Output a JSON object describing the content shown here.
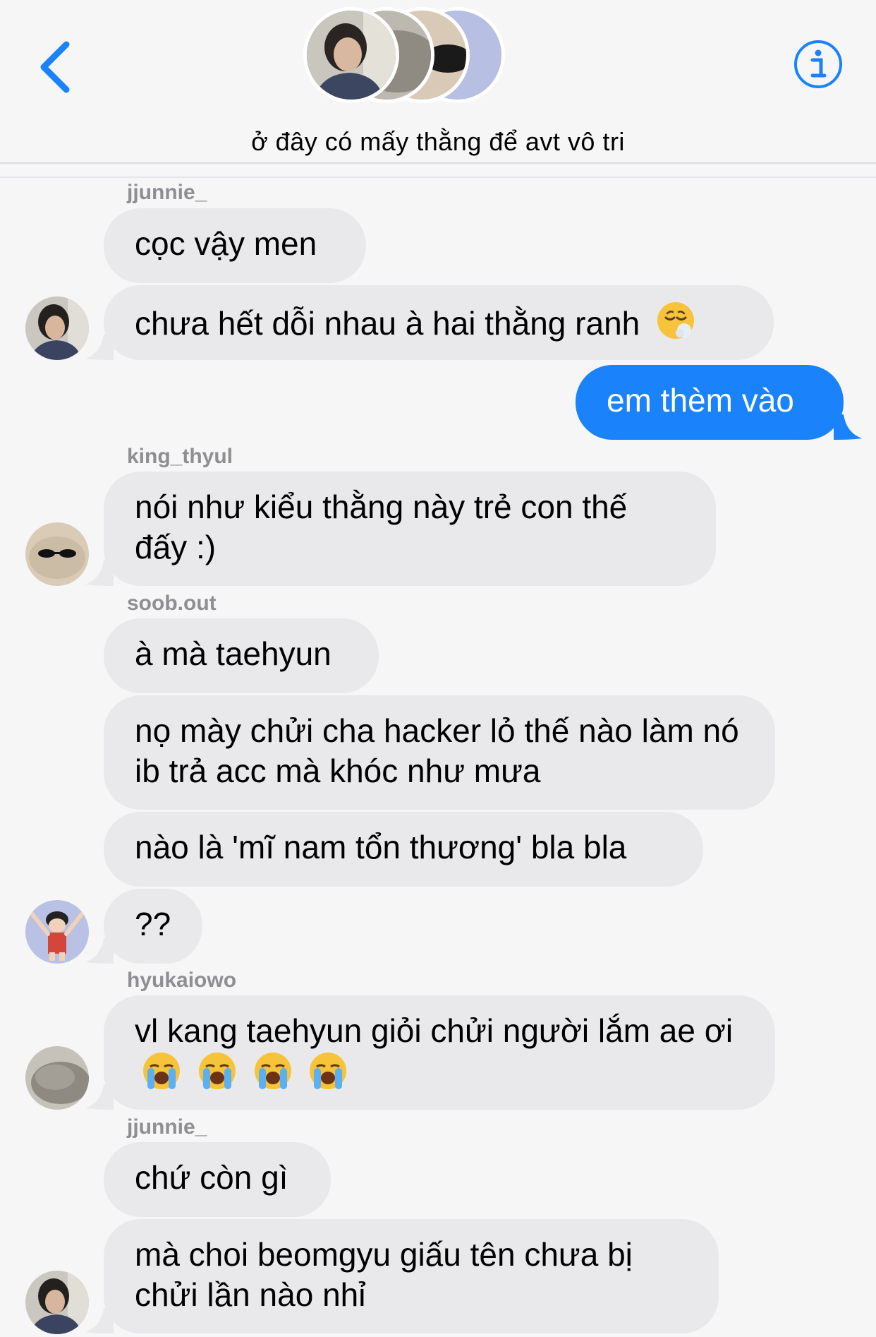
{
  "header": {
    "title": "ở đây có mấy thằng để avt vô tri",
    "accent": "#1a82fb"
  },
  "messages": [
    {
      "user": "jjunnie_",
      "text": "cọc vậy men"
    },
    {
      "user": "jjunnie_",
      "text": "chưa hết dỗi nhau à hai thằng ranh"
    },
    {
      "user": "me",
      "text": "em thèm vào"
    },
    {
      "user": "king_thyul",
      "text": "nói như kiểu thằng này trẻ con thế đấy :)"
    },
    {
      "user": "soob.out",
      "text": "à mà taehyun"
    },
    {
      "user": "soob.out",
      "text": "nọ mày chửi cha hacker lỏ thế nào làm nó ib trả acc mà khóc như mưa"
    },
    {
      "user": "soob.out",
      "text": "nào là 'mĩ nam tổn thương' bla bla"
    },
    {
      "user": "soob.out",
      "text": "??"
    },
    {
      "user": "hyukaiowo",
      "text": "vl kang taehyun giỏi chửi người lắm ae ơi"
    },
    {
      "user": "jjunnie_",
      "text": "chứ còn gì"
    },
    {
      "user": "jjunnie_",
      "text": "mà choi beomgyu giấu tên chưa bị chửi lần nào nhỉ"
    }
  ],
  "usernames": {
    "u1": "jjunnie_",
    "u2": "king_thyul",
    "u3": "soob.out",
    "u4": "hyukaiowo",
    "u5": "jjunnie_"
  },
  "icons": {
    "back": "chevron-left-icon",
    "info": "info-circle-icon",
    "emoji_sigh": "face-exhaling-emoji",
    "emoji_cry": "loudly-crying-face-emoji"
  }
}
